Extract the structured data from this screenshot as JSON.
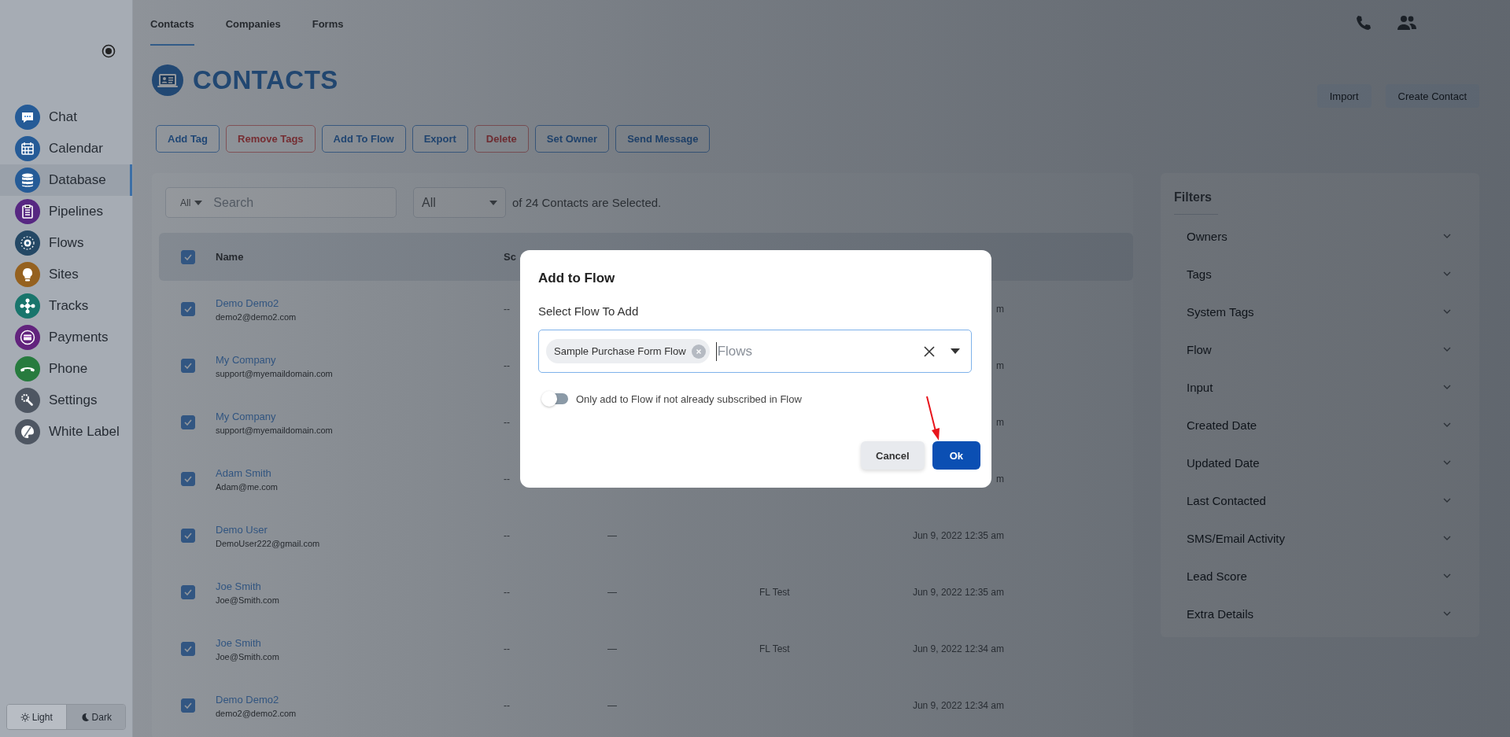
{
  "sidebar": {
    "items": [
      {
        "label": "Chat",
        "color": "#255b97",
        "selected": false
      },
      {
        "label": "Calendar",
        "color": "#255b97",
        "selected": false
      },
      {
        "label": "Database",
        "color": "#255b97",
        "selected": true
      },
      {
        "label": "Pipelines",
        "color": "#572782",
        "selected": false
      },
      {
        "label": "Flows",
        "color": "#244865",
        "selected": false
      },
      {
        "label": "Sites",
        "color": "#95611f",
        "selected": false
      },
      {
        "label": "Tracks",
        "color": "#19756c",
        "selected": false
      },
      {
        "label": "Payments",
        "color": "#62237d",
        "selected": false
      },
      {
        "label": "Phone",
        "color": "#277b3e",
        "selected": false
      },
      {
        "label": "Settings",
        "color": "#4e5662",
        "selected": false
      },
      {
        "label": "White Label",
        "color": "#4e5662",
        "selected": false
      }
    ]
  },
  "theme_switch": [
    {
      "label": "Light",
      "selected": true
    },
    {
      "label": "Dark",
      "selected": false
    }
  ],
  "tabs": [
    {
      "label": "Contacts",
      "selected": true
    },
    {
      "label": "Companies",
      "selected": false
    },
    {
      "label": "Forms",
      "selected": false
    }
  ],
  "page_title": "CONTACTS",
  "header_buttons": [
    "Import",
    "Create Contact"
  ],
  "actions": [
    {
      "label": "Add Tag",
      "kind": "default"
    },
    {
      "label": "Remove Tags",
      "kind": "danger"
    },
    {
      "label": "Add To Flow",
      "kind": "default"
    },
    {
      "label": "Export",
      "kind": "default"
    },
    {
      "label": "Delete",
      "kind": "danger"
    },
    {
      "label": "Set Owner",
      "kind": "default"
    },
    {
      "label": "Send Message",
      "kind": "default"
    }
  ],
  "search": {
    "scope": "All",
    "placeholder": "Search"
  },
  "selection": {
    "value": "All",
    "note": "of 24 Contacts are Selected."
  },
  "table": {
    "all_checked": true,
    "columns": [
      "Name",
      "Sc"
    ],
    "rows": [
      {
        "checked": true,
        "name": "Demo Demo2",
        "email": "demo2@demo2.com",
        "column_2": "--",
        "column_5": "m"
      },
      {
        "checked": true,
        "name": "My Company",
        "email": "support@myemaildomain.com",
        "column_2": "--",
        "column_5": "m"
      },
      {
        "checked": true,
        "name": "My Company",
        "email": "support@myemaildomain.com",
        "column_2": "--",
        "column_5": "m"
      },
      {
        "checked": true,
        "name": "Adam Smith",
        "email": "Adam@me.com",
        "column_2": "--",
        "column_5": "m"
      },
      {
        "checked": true,
        "name": "Demo User",
        "email": "DemoUser222@gmail.com",
        "column_2": "--",
        "column_3": "—",
        "column_5": "Jun 9, 2022 12:35 am"
      },
      {
        "checked": true,
        "name": "Joe Smith",
        "email": "Joe@Smith.com",
        "column_2": "--",
        "column_3": "—",
        "column_4": "FL Test",
        "column_5": "Jun 9, 2022 12:35 am"
      },
      {
        "checked": true,
        "name": "Joe Smith",
        "email": "Joe@Smith.com",
        "column_2": "--",
        "column_3": "—",
        "column_4": "FL Test",
        "column_5": "Jun 9, 2022 12:34 am"
      },
      {
        "checked": true,
        "name": "Demo Demo2",
        "email": "demo2@demo2.com",
        "column_2": "--",
        "column_3": "—",
        "column_5": "Jun 9, 2022 12:34 am"
      }
    ]
  },
  "filters": {
    "title": "Filters",
    "items": [
      "Owners",
      "Tags",
      "System Tags",
      "Flow",
      "Input",
      "Created Date",
      "Updated Date",
      "Last Contacted",
      "SMS/Email Activity",
      "Lead Score",
      "Extra Details"
    ]
  },
  "dialog": {
    "title": "Add to Flow",
    "label": "Select Flow To Add",
    "chips": [
      "Sample Purchase Form Flow"
    ],
    "placeholder": "Flows",
    "toggle": {
      "label": "Only add to Flow if not already subscribed in Flow",
      "on": false
    },
    "buttons": [
      {
        "label": "Cancel",
        "kind": "secondary"
      },
      {
        "label": "Ok",
        "kind": "primary"
      }
    ]
  }
}
